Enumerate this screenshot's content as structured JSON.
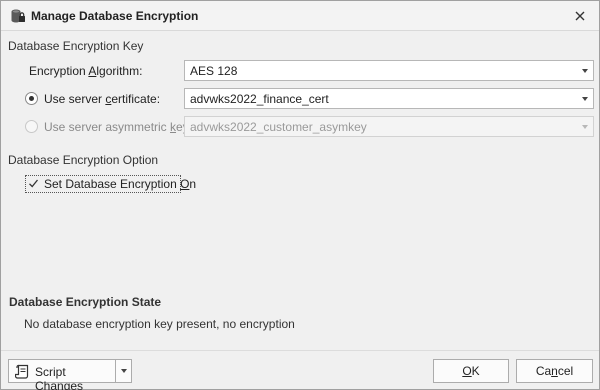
{
  "window": {
    "title": "Manage Database Encryption"
  },
  "encryption_key": {
    "section_label": "Database Encryption Key",
    "algorithm_label_pre": "Encryption ",
    "algorithm_label_accel": "A",
    "algorithm_label_post": "lgorithm:",
    "algorithm_value": "AES 128",
    "server_cert_label_pre": "Use server ",
    "server_cert_label_accel": "c",
    "server_cert_label_post": "ertificate:",
    "server_cert_value": "advwks2022_finance_cert",
    "server_cert_selected": true,
    "asym_key_label_pre": "Use server asymmetric ",
    "asym_key_label_accel": "k",
    "asym_key_label_post": "ey:",
    "asym_key_value": "advwks2022_customer_asymkey",
    "asym_key_selected": false
  },
  "encryption_option": {
    "section_label": "Database Encryption Option",
    "checkbox_label_pre": "Set Database Encryption ",
    "checkbox_label_accel": "O",
    "checkbox_label_post": "n",
    "checked": true
  },
  "encryption_state": {
    "title": "Database Encryption State",
    "text": "No database encryption key present, no encryption"
  },
  "footer": {
    "script_changes_label": "Script Changes",
    "ok_label_accel": "O",
    "ok_label_post": "K",
    "cancel_label_pre": "Ca",
    "cancel_label_accel": "n",
    "cancel_label_post": "cel"
  },
  "icons": {
    "title_icon": "database-lock-icon",
    "close_icon": "close-icon",
    "script_icon": "script-document-icon",
    "dropdown_icon": "chevron-down-icon"
  }
}
